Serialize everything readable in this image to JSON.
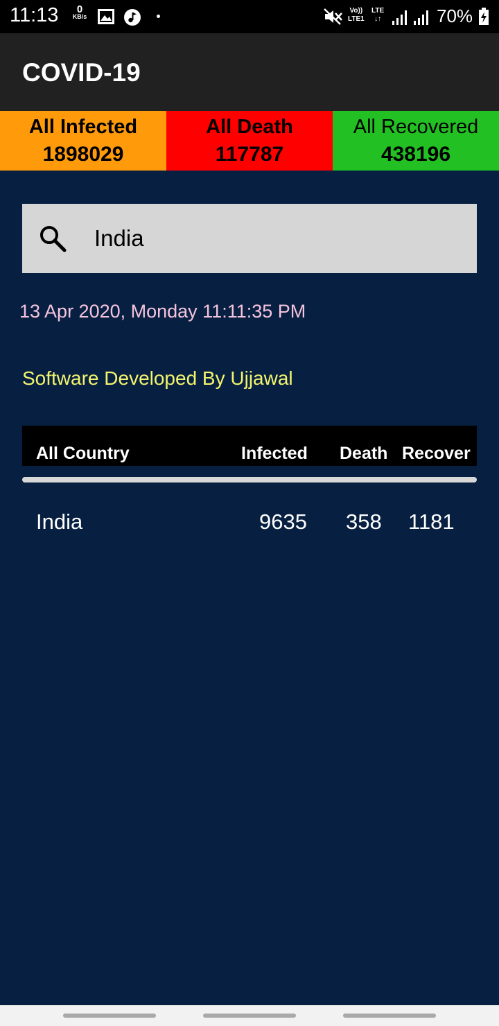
{
  "status_bar": {
    "time": "11:13",
    "data_speed_value": "0",
    "data_speed_unit": "KB/s",
    "network_volte_top": "Vo))",
    "network_volte_bottom": "LTE1",
    "network_lte": "LTE",
    "battery": "70%",
    "icons": [
      "gallery-icon",
      "music-icon",
      "mute-icon",
      "signal-icon",
      "signal-icon",
      "battery-icon"
    ]
  },
  "app_bar": {
    "title": "COVID-19"
  },
  "summary": {
    "infected": {
      "label": "All Infected",
      "value": "1898029",
      "color": "#ff9a0b"
    },
    "death": {
      "label": "All Death",
      "value": "117787",
      "color": "#fe0000"
    },
    "recovered": {
      "label": "All Recovered",
      "value": "438196",
      "color": "#22c022"
    }
  },
  "search": {
    "value": "India",
    "icon": "search-icon"
  },
  "datetime": "13 Apr 2020, Monday 11:11:35 PM",
  "developer": "Software Developed By Ujjawal",
  "table": {
    "headers": {
      "country": "All Country",
      "infected": "Infected",
      "death": "Death",
      "recover": "Recover"
    },
    "rows": [
      {
        "country": "India",
        "infected": "9635",
        "death": "358",
        "recover": "1181"
      }
    ]
  },
  "colors": {
    "background": "#072042",
    "app_bar": "#212121",
    "datetime": "#f6c3dd",
    "developer": "#f3f46d"
  }
}
